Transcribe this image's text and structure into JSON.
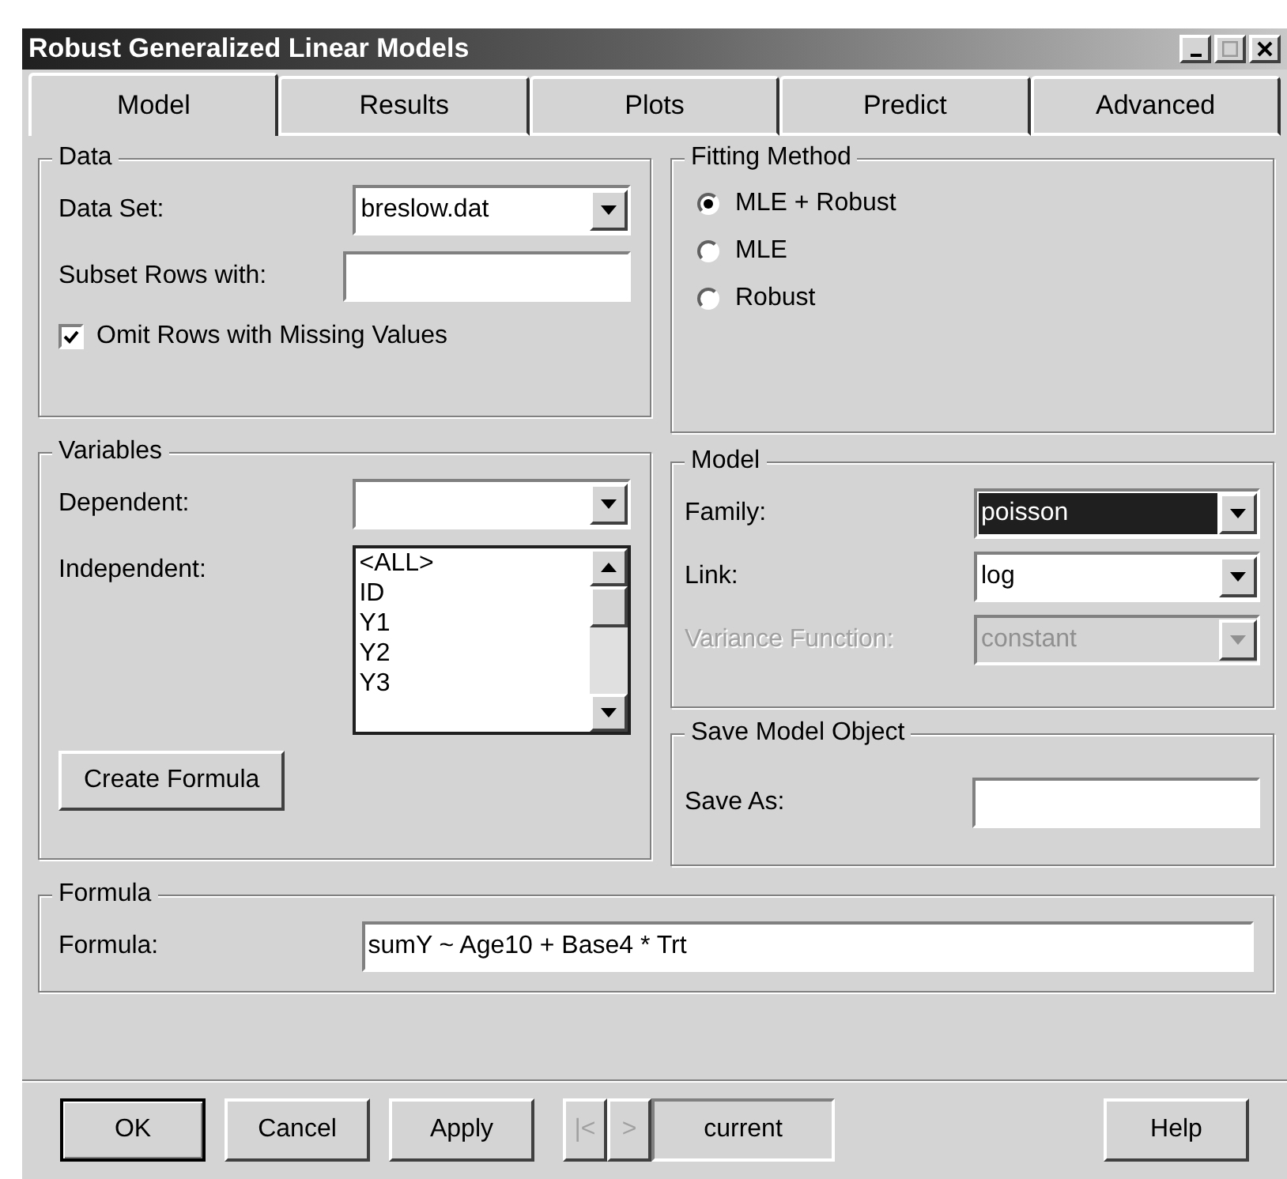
{
  "window": {
    "title": "Robust Generalized Linear Models"
  },
  "tabs": [
    {
      "label": "Model",
      "selected": true
    },
    {
      "label": "Results",
      "selected": false
    },
    {
      "label": "Plots",
      "selected": false
    },
    {
      "label": "Predict",
      "selected": false
    },
    {
      "label": "Advanced",
      "selected": false
    }
  ],
  "data_group": {
    "title": "Data",
    "data_set": {
      "label": "Data Set:",
      "value": "breslow.dat"
    },
    "subset": {
      "label": "Subset Rows with:"
    },
    "omit_missing": {
      "label": "Omit Rows with Missing Values",
      "checked": true
    }
  },
  "fitting_method": {
    "title": "Fitting Method",
    "options": [
      {
        "label": "MLE + Robust",
        "selected": true
      },
      {
        "label": "MLE",
        "selected": false
      },
      {
        "label": "Robust",
        "selected": false
      }
    ]
  },
  "variables": {
    "title": "Variables",
    "dependent": {
      "label": "Dependent:"
    },
    "independent": {
      "label": "Independent:",
      "items": [
        "<ALL>",
        "ID",
        "Y1",
        "Y2",
        "Y3"
      ]
    },
    "create_button": "Create Formula"
  },
  "model": {
    "title": "Model",
    "fields": [
      {
        "label": "Family:",
        "value": "poisson",
        "highlighted": true,
        "disabled": false
      },
      {
        "label": "Link:",
        "value": "log",
        "highlighted": false,
        "disabled": false
      },
      {
        "label": "Variance Function:",
        "value": "constant",
        "highlighted": false,
        "disabled": true
      }
    ]
  },
  "save_model": {
    "title": "Save Model Object",
    "label": "Save As:"
  },
  "formula": {
    "title": "Formula",
    "label": "Formula:",
    "value": "sumY ~ Age10 + Base4 * Trt"
  },
  "buttons": {
    "ok": "OK",
    "cancel": "Cancel",
    "apply": "Apply",
    "nav": [
      {
        "label": "|<",
        "disabled": true
      },
      {
        "label": ">",
        "disabled": true
      }
    ],
    "current": "current",
    "help": "Help"
  }
}
